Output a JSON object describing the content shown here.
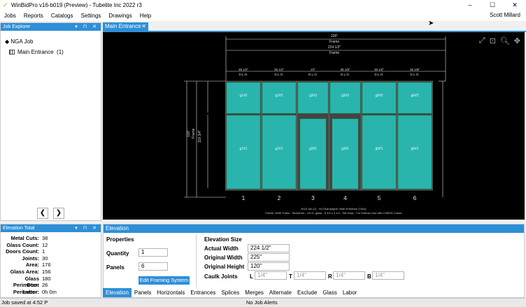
{
  "window": {
    "title": "WinBidPro v16-b019 (Preview) - Tubelite Inc 2022 r3",
    "minimize": "–",
    "maximize": "☐",
    "close": "✕"
  },
  "menu": {
    "items": [
      "Jobs",
      "Reports",
      "Catalogs",
      "Settings",
      "Drawings",
      "Help"
    ],
    "user": "Scott Millard"
  },
  "explorer": {
    "title": "Job Explorer",
    "root": "NGA Job",
    "child": "Main Entrance  (1)",
    "prev": "❮",
    "next": "❯"
  },
  "doc_tab": {
    "label": "Main Entrance"
  },
  "drawing": {
    "dims": {
      "overall": "226\"",
      "overall_label": "Frame",
      "width_frame": "224 1/2\"",
      "width_frame_label": "Frame"
    },
    "dlo_labels": [
      "36 1/2\"",
      "35 1/2\"",
      "23\"",
      "35 1/8\"",
      "36 1/2\"",
      "36 1/8\""
    ],
    "dlo_sub": "D.L.O.",
    "upper_lites": [
      "g1#2",
      "g2#2",
      "g3#3",
      "g3#2",
      "g5#2",
      "g6#2"
    ],
    "lower_lites": [
      "g1#1",
      "g2#1",
      "g3#1",
      "g3#1",
      "g5#1",
      "g6#1"
    ],
    "bay_numbers": [
      "1",
      "2",
      "3",
      "4",
      "5",
      "6"
    ],
    "caption1": "NGA Job (1) - Hi-Champagne: Main Entrance (Thus)",
    "caption2": "Frame: 4500 Tubes - Storefront - 1/4 in. glass - 5 3/4 x 4 1/2 - Std Hdwr - For Exterior Use with CHESS Cutout",
    "left_labels": [
      "120\"",
      "Frame",
      "119 3/4\""
    ]
  },
  "elevation_total": {
    "title": "Elevation Total",
    "rows": [
      {
        "label": "Metal Cuts:",
        "value": "38"
      },
      {
        "label": "Glass Count:",
        "value": "12"
      },
      {
        "label": "Doors Count:",
        "value": "1"
      },
      {
        "label": "Joints:",
        "value": "30"
      },
      {
        "label": "Area:",
        "value": "176"
      },
      {
        "label": "Glass Area:",
        "value": "156"
      },
      {
        "label": "Glass Perimeter:",
        "value": "180"
      },
      {
        "label": "Door Perimeter:",
        "value": "26"
      },
      {
        "label": "Labor:",
        "value": "0h 0m"
      }
    ]
  },
  "elevation": {
    "title": "Elevation",
    "properties": "Properties",
    "quantity_label": "Quantity",
    "quantity": "1",
    "panels_label": "Panels",
    "panels": "6",
    "edit_button": "Edit Framing System",
    "size_title": "Elevation Size",
    "actual_width_label": "Actual Width",
    "actual_width": "224 1/2\"",
    "original_width_label": "Original Width",
    "original_width": "225\"",
    "original_height_label": "Original Height",
    "original_height": "120\"",
    "caulk_label": "Caulk Joints",
    "caulk": [
      {
        "side": "L",
        "value": "1/4\""
      },
      {
        "side": "T",
        "value": "1/4\""
      },
      {
        "side": "R",
        "value": "1/4\""
      },
      {
        "side": "B",
        "value": "1/4\""
      }
    ]
  },
  "bottom_tabs": [
    "Elevation",
    "Panels",
    "Horizontals",
    "Entrances",
    "Splices",
    "Merges",
    "Alternate",
    "Exclude",
    "Glass",
    "Labor"
  ],
  "status": {
    "left": "Job saved at 4:52 P",
    "center": "No Job Alerts"
  },
  "colors": {
    "accent": "#2d8fd8",
    "glass": "#29b5ad",
    "drawing_bg": "#000000"
  },
  "icons": {
    "fit": "fit-icon",
    "zoom_window": "zoom-window-icon",
    "zoom": "zoom-icon",
    "pan": "pan-icon"
  }
}
